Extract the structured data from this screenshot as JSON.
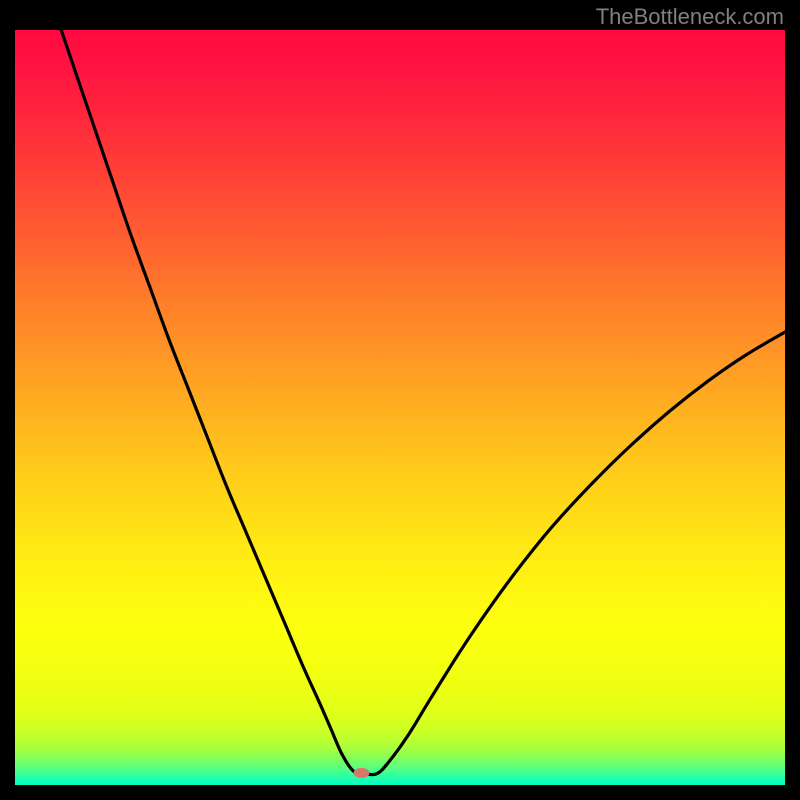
{
  "watermark": "TheBottleneck.com",
  "chart_data": {
    "type": "line",
    "title": "",
    "xlabel": "",
    "ylabel": "",
    "xlim": [
      0,
      100
    ],
    "ylim": [
      0,
      100
    ],
    "gradient_bands": [
      {
        "stop": 0.0,
        "color": "#ff0940"
      },
      {
        "stop": 0.05,
        "color": "#ff1440"
      },
      {
        "stop": 0.11,
        "color": "#ff253d"
      },
      {
        "stop": 0.17,
        "color": "#ff3938"
      },
      {
        "stop": 0.23,
        "color": "#ff4f34"
      },
      {
        "stop": 0.3,
        "color": "#ff672f"
      },
      {
        "stop": 0.36,
        "color": "#ff7e2a"
      },
      {
        "stop": 0.42,
        "color": "#ff9326"
      },
      {
        "stop": 0.49,
        "color": "#ffab21"
      },
      {
        "stop": 0.55,
        "color": "#ffc01d"
      },
      {
        "stop": 0.61,
        "color": "#ffd319"
      },
      {
        "stop": 0.68,
        "color": "#ffe714"
      },
      {
        "stop": 0.74,
        "color": "#fff611"
      },
      {
        "stop": 0.79,
        "color": "#fdff0e"
      },
      {
        "stop": 0.84,
        "color": "#f5ff10"
      },
      {
        "stop": 0.87,
        "color": "#edff13"
      },
      {
        "stop": 0.901,
        "color": "#e2ff18"
      },
      {
        "stop": 0.92,
        "color": "#d3ff20"
      },
      {
        "stop": 0.934,
        "color": "#c5ff29"
      },
      {
        "stop": 0.945,
        "color": "#b3ff35"
      },
      {
        "stop": 0.953,
        "color": "#a3ff41"
      },
      {
        "stop": 0.96,
        "color": "#91ff50"
      },
      {
        "stop": 0.965,
        "color": "#82ff5c"
      },
      {
        "stop": 0.97,
        "color": "#71ff6a"
      },
      {
        "stop": 0.975,
        "color": "#60ff78"
      },
      {
        "stop": 0.98,
        "color": "#4dff87"
      },
      {
        "stop": 0.985,
        "color": "#39ff98"
      },
      {
        "stop": 0.99,
        "color": "#27ffa7"
      },
      {
        "stop": 0.994,
        "color": "#16ffb5"
      },
      {
        "stop": 1.0,
        "color": "#00ffc7"
      }
    ],
    "curve": {
      "comment": "V-shaped curve: falls from top-left, bottoms out near x≈44, rises to right",
      "x": [
        6.0,
        8.0,
        10.0,
        12.5,
        15.0,
        17.5,
        20.0,
        22.5,
        25.0,
        27.5,
        30.0,
        32.5,
        35.0,
        37.5,
        39.5,
        41.0,
        42.5,
        44.0,
        45.5,
        47.0,
        48.5,
        51.0,
        54.0,
        58.0,
        62.0,
        66.0,
        70.0,
        75.0,
        80.0,
        85.0,
        90.0,
        95.0,
        100.0
      ],
      "y": [
        100.0,
        94.0,
        88.0,
        80.5,
        73.0,
        66.0,
        59.0,
        52.5,
        46.0,
        39.5,
        33.5,
        27.5,
        21.5,
        15.5,
        11.0,
        7.5,
        4.0,
        1.8,
        1.5,
        1.5,
        3.0,
        6.5,
        11.5,
        18.0,
        24.0,
        29.5,
        34.5,
        40.0,
        45.0,
        49.5,
        53.5,
        57.0,
        60.0
      ]
    },
    "marker": {
      "x": 45.0,
      "y": 1.6,
      "color": "#d6766d",
      "rx": 8,
      "ry": 5
    }
  }
}
